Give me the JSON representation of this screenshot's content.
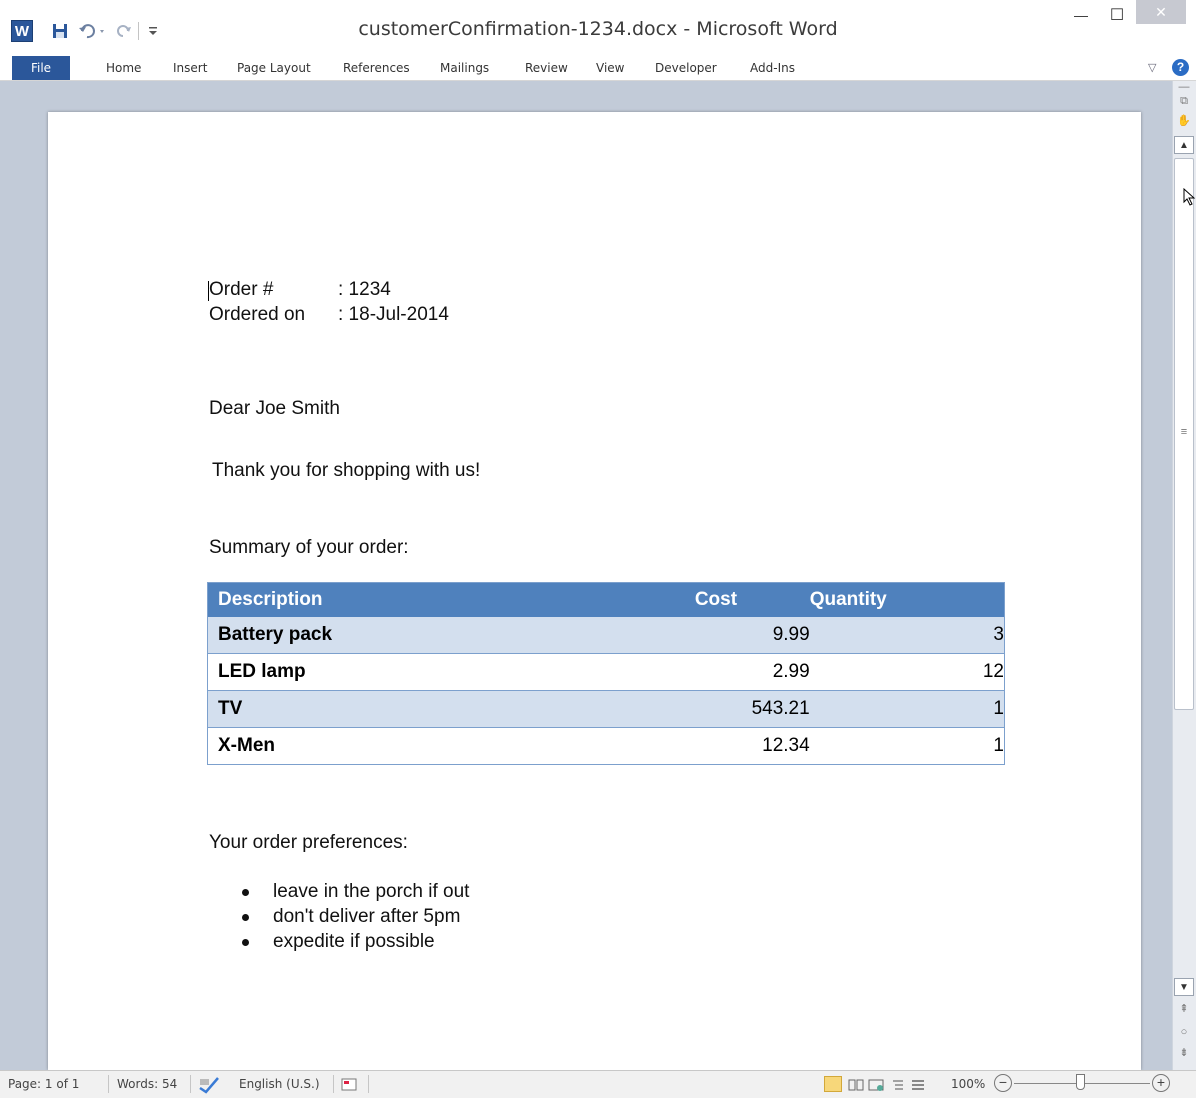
{
  "window": {
    "title": "customerConfirmation-1234.docx - Microsoft Word",
    "app_icon_letter": "W",
    "minimize_glyph": "—",
    "maximize_glyph": "☐",
    "close_glyph": "✕"
  },
  "quick_access": {
    "save_icon": "floppy-disk-icon",
    "undo_icon": "undo-arrow-icon",
    "redo_icon": "redo-arrow-icon"
  },
  "ribbon": {
    "tabs": [
      "File",
      "Home",
      "Insert",
      "Page Layout",
      "References",
      "Mailings",
      "Review",
      "View",
      "Developer",
      "Add-Ins"
    ],
    "collapse_glyph": "▽",
    "help_glyph": "?"
  },
  "document": {
    "order_label": "Order #",
    "order_value": ": 1234",
    "ordered_on_label": "Ordered on",
    "ordered_on_value": ": 18-Jul-2014",
    "greeting": "Dear Joe Smith",
    "thanks": "Thank you for shopping with us!",
    "summary_heading": "Summary of your order:",
    "table": {
      "headers": [
        "Description",
        "Cost",
        "Quantity"
      ],
      "rows": [
        {
          "description": "Battery pack",
          "cost": "9.99",
          "quantity": "3"
        },
        {
          "description": "LED lamp",
          "cost": "2.99",
          "quantity": "12"
        },
        {
          "description": "TV",
          "cost": "543.21",
          "quantity": "1"
        },
        {
          "description": "X-Men",
          "cost": "12.34",
          "quantity": "1"
        }
      ]
    },
    "preferences_heading": "Your order preferences:",
    "preferences": [
      "leave in the porch if out",
      "don't deliver after 5pm",
      "expedite if possible"
    ]
  },
  "status_bar": {
    "page": "Page: 1 of 1",
    "words": "Words: 54",
    "language": "English (U.S.)",
    "zoom": "100%",
    "zoom_out_glyph": "−",
    "zoom_in_glyph": "+"
  },
  "colors": {
    "accent": "#2b579a",
    "table_header": "#4f81bd",
    "table_band": "#d3dfee",
    "doc_background": "#c2cbd8"
  }
}
